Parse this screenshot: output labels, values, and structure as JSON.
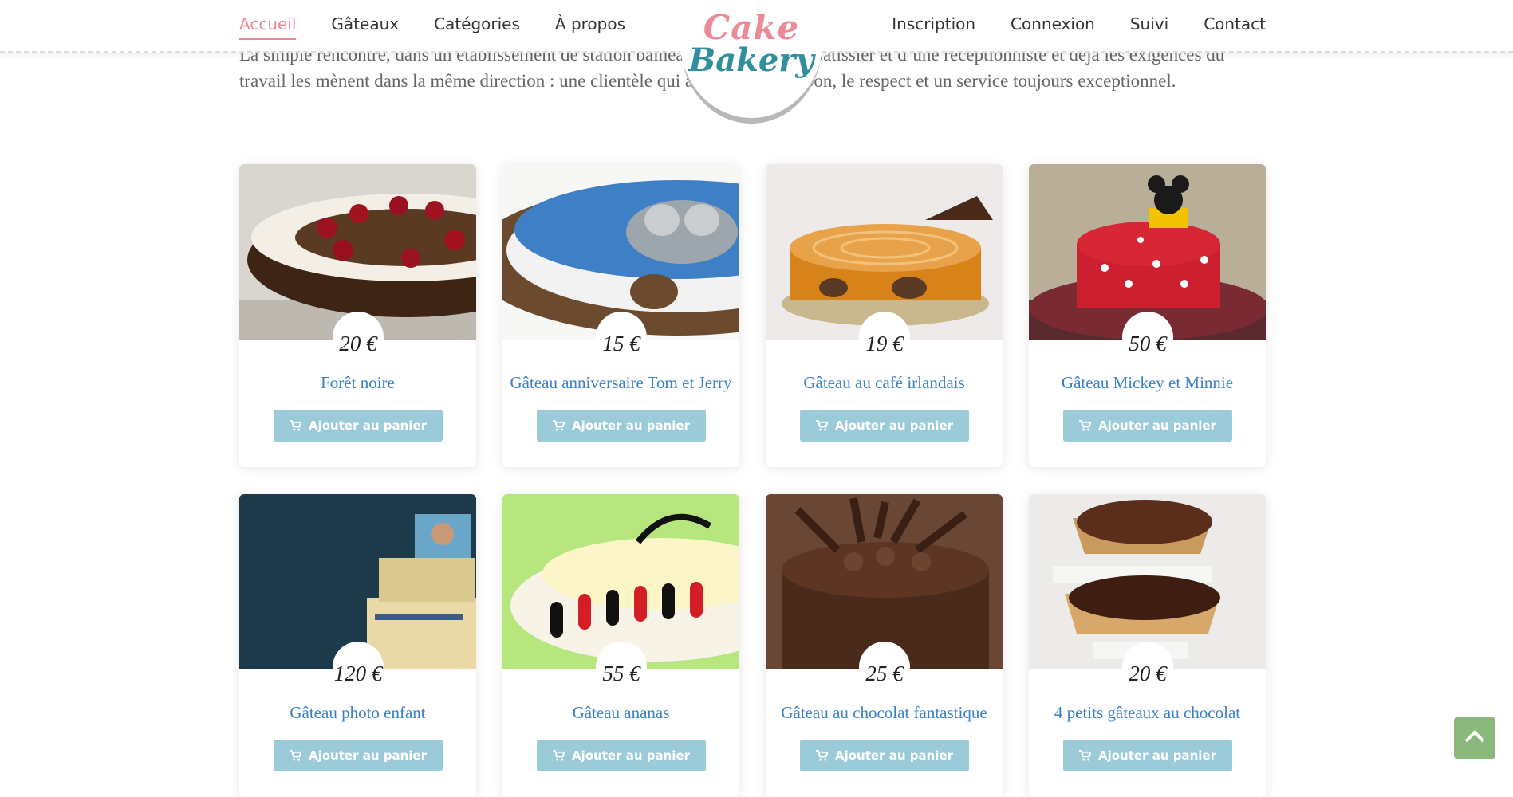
{
  "nav": {
    "left": [
      "Accueil",
      "Gâteaux",
      "Catégories",
      "À propos"
    ],
    "right": [
      "Inscription",
      "Connexion",
      "Suivi",
      "Contact"
    ]
  },
  "logo": {
    "line1": "Cake",
    "line2": "Bakery"
  },
  "intro": "La simple rencontre, dans un établissement de station balnéaire en 1982, d’un pâtissier et d’une réceptionniste et déjà les exigences du travail les mènent dans la même direction : une clientèle qui aime le beau, le bon, le respect et un service toujours exceptionnel.",
  "cart_label": "Ajouter au panier",
  "products": [
    {
      "price": "20 €",
      "name": "Forêt noire"
    },
    {
      "price": "15 €",
      "name": "Gâteau anniversaire Tom et Jerry"
    },
    {
      "price": "19 €",
      "name": "Gâteau au café irlandais"
    },
    {
      "price": "50 €",
      "name": "Gâteau Mickey et Minnie"
    },
    {
      "price": "120 €",
      "name": "Gâteau photo enfant"
    },
    {
      "price": "55 €",
      "name": "Gâteau ananas"
    },
    {
      "price": "25 €",
      "name": "Gâteau au chocolat fantastique"
    },
    {
      "price": "20 €",
      "name": "4 petits gâteaux au chocolat"
    }
  ],
  "colors": {
    "accent_pink": "#e8899b",
    "title_blue": "#3a80c8",
    "button_blue": "#9bcad8",
    "top_button_green": "#8ab87c"
  },
  "icons": {
    "cart": "cart-icon",
    "back_to_top": "chevron-up-icon"
  }
}
